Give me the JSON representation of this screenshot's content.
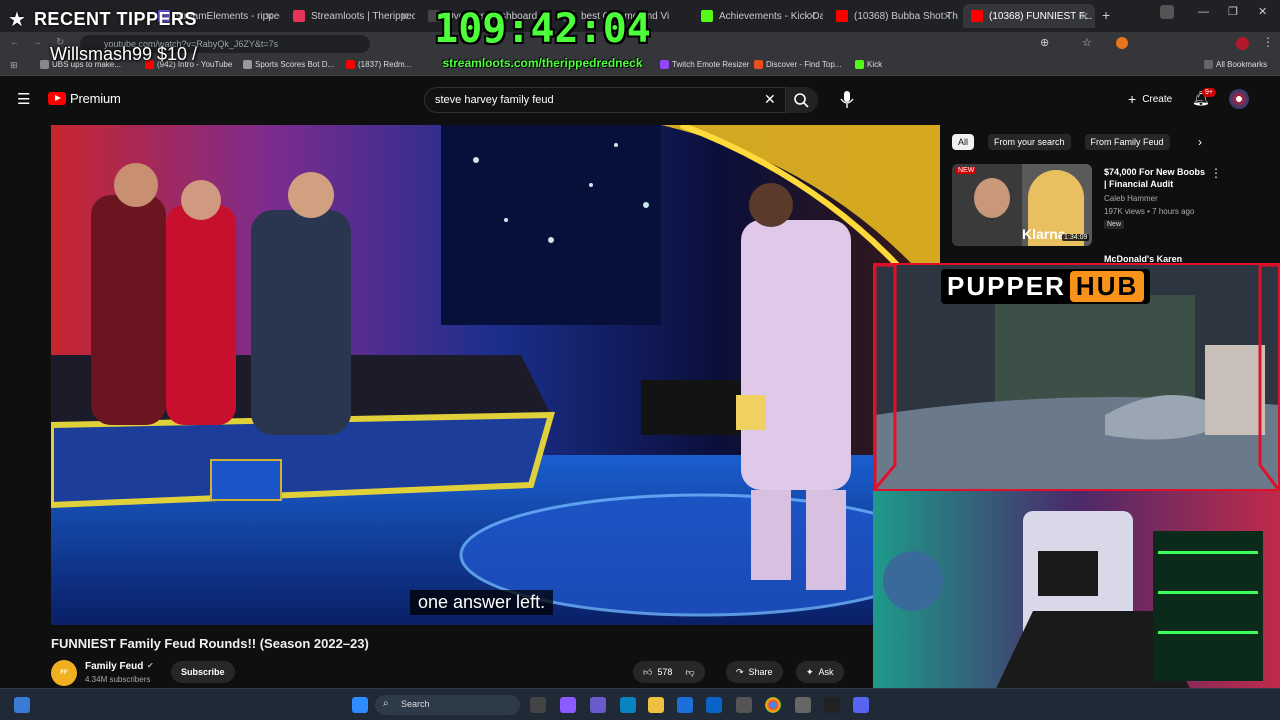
{
  "browser": {
    "tabs": [
      {
        "label": "streamElements - rippedr",
        "color": "#7b5cff"
      },
      {
        "label": "Streamloots | Theripped",
        "color": "#e8345a"
      },
      {
        "label": "Overlays Dashboard",
        "color": "#444"
      },
      {
        "label": "best Chrome and Vi",
        "color": "#444"
      },
      {
        "label": "Achievements - Kick Da",
        "color": "#53fc18"
      },
      {
        "label": "(10368) Bubba Shot The",
        "color": "#ff0000"
      },
      {
        "label": "(10368) FUNNIEST F...",
        "color": "#ff0000"
      }
    ],
    "url": "youtube.com/watch?v=RabyQk_J6ZY&t=7s",
    "bookmarks": [
      {
        "label": "UBS ups to make...",
        "color": "#888"
      },
      {
        "label": "(942) Intro - YouTube",
        "color": "#ff0000"
      },
      {
        "label": "Sports Scores Bot D...",
        "color": "#999"
      },
      {
        "label": "(1837) Redm...",
        "color": "#ff0000"
      },
      {
        "label": "Twitch Emote Resizer",
        "color": "#9146ff"
      },
      {
        "label": "Discover - Find Top...",
        "color": "#e94e1b"
      },
      {
        "label": "Kick",
        "color": "#53fc18"
      }
    ],
    "all_bookmarks_label": "All Bookmarks"
  },
  "overlay": {
    "tippers_label": "RECENT TIPPERS",
    "tipper": "Willsmash99 $10 /",
    "timer": "109:42:04",
    "stream_url": "streamloots.com/therippedredneck",
    "panel_title_left": "PUPPER",
    "panel_title_right": "HUB"
  },
  "youtube": {
    "logo_label": "Premium",
    "search_value": "steve harvey family feud",
    "create_label": "Create",
    "notification_count": "9+",
    "caption": "one answer left.",
    "video_title": "FUNNIEST Family Feud Rounds!! (Season 2022–23)",
    "channel_name": "Family Feud",
    "subscribers": "4.34M subscribers",
    "subscribe_label": "Subscribe",
    "likes": "578",
    "share_label": "Share",
    "ask_label": "Ask",
    "chips": [
      "All",
      "From your search",
      "From Family Feud"
    ],
    "recommendations": [
      {
        "title": "$74,000 For New Boobs | Financial Audit",
        "channel": "Caleb Hammer",
        "meta": "197K views • 7 hours ago",
        "badge": "New",
        "duration": "1:34:09",
        "thumb_tag": "NEW",
        "thumb_text": "Klarna"
      },
      {
        "title": "McDonald's Karen",
        "channel": "",
        "meta": "",
        "badge": "",
        "duration": "",
        "thumb_tag": "",
        "thumb_text": ""
      }
    ]
  },
  "taskbar": {
    "search_label": "Search"
  },
  "colors": {
    "accent_red": "#ff0000",
    "overlay_green": "#4cff3a",
    "panel_red": "#e0102a"
  }
}
